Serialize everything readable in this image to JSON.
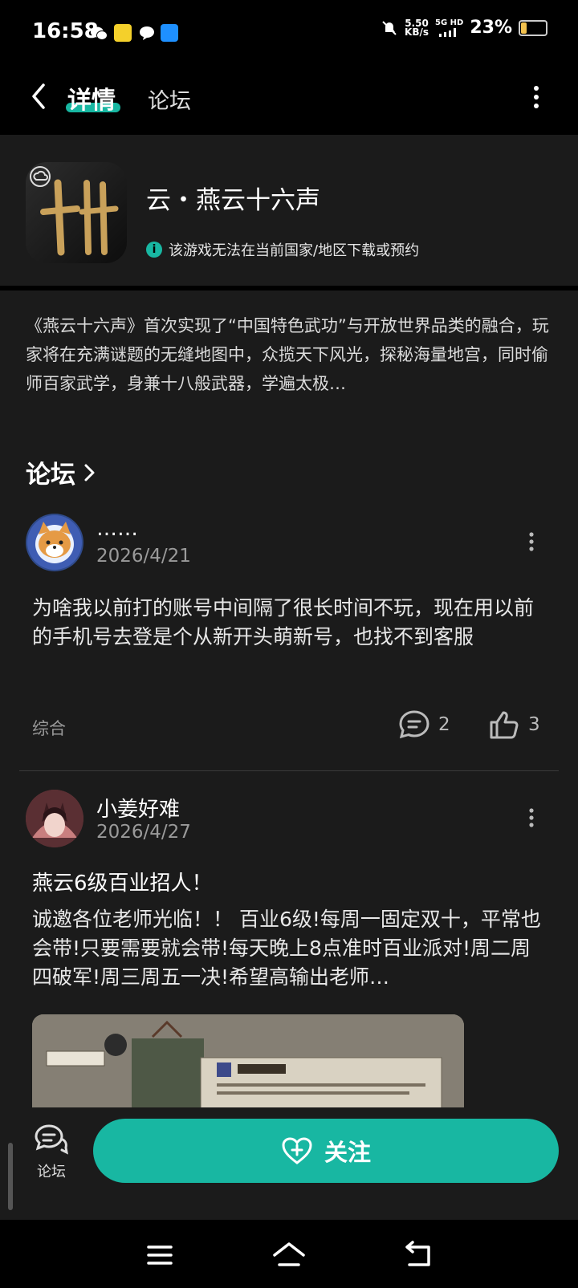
{
  "status_bar": {
    "time": "16:58",
    "net_speed_value": "5.50",
    "net_speed_unit": "KB/s",
    "network": "5G HD",
    "battery": "23%",
    "battery_level": 0.23
  },
  "header": {
    "tab_detail": "详情",
    "tab_forum": "论坛"
  },
  "app": {
    "title": "云・燕云十六声",
    "notice": "该游戏无法在当前国家/地区下载或预约"
  },
  "description": "《燕云十六声》首次实现了“中国特色武功”与开放世界品类的融合，玩家将在充满谜题的无缝地图中，众揽天下风光，探秘海量地宫，同时偷师百家武学，身兼十八般武器，学遍太极…",
  "forum": {
    "section_title": "论坛",
    "posts": [
      {
        "user": "……",
        "date": "2026/4/21",
        "body": "为啥我以前打的账号中间隔了很长时间不玩，现在用以前的手机号去登是个从新开头萌新号，也找不到客服",
        "tag": "综合",
        "comments": "2",
        "likes": "3"
      },
      {
        "user": "小姜好难",
        "date": "2026/4/27",
        "title": "燕云6级百业招人！",
        "body": "诚邀各位老师光临！！ 百业6级!每周一固定双十，平常也会带!只要需要就会带!每天晚上8点准时百业派对!周二周四破军!周三周五一决!希望高输出老师…"
      }
    ]
  },
  "bottom": {
    "forum_label": "论坛",
    "follow_label": "关注"
  },
  "colors": {
    "accent": "#18b7a2",
    "background": "#1b1b1b"
  }
}
